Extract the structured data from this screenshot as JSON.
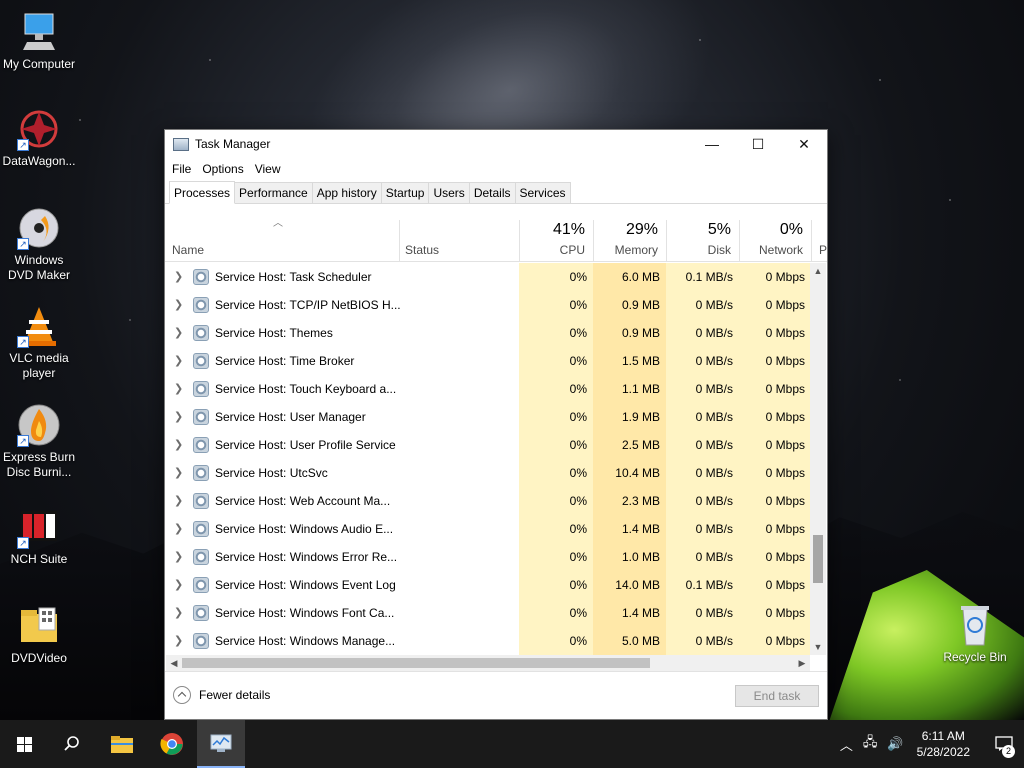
{
  "desktop": {
    "icons": [
      {
        "label": "My Computer"
      },
      {
        "label": "DataWagon..."
      },
      {
        "label": "Windows DVD Maker"
      },
      {
        "label": "VLC media player"
      },
      {
        "label": "Express Burn Disc Burni..."
      },
      {
        "label": "NCH Suite"
      },
      {
        "label": "DVDVideo"
      },
      {
        "label": "Recycle Bin"
      }
    ]
  },
  "window": {
    "title": "Task Manager",
    "controls": {
      "minimize": "—",
      "maximize": "☐",
      "close": "✕"
    },
    "menu": [
      "File",
      "Options",
      "View"
    ],
    "tabs": [
      "Processes",
      "Performance",
      "App history",
      "Startup",
      "Users",
      "Details",
      "Services"
    ],
    "active_tab": "Processes",
    "columns": {
      "name": "Name",
      "status": "Status",
      "cpu": {
        "pct": "41%",
        "label": "CPU"
      },
      "memory": {
        "pct": "29%",
        "label": "Memory"
      },
      "disk": {
        "pct": "5%",
        "label": "Disk"
      },
      "network": {
        "pct": "0%",
        "label": "Network"
      },
      "extra": "P"
    },
    "rows": [
      {
        "name": "Service Host: Task Scheduler",
        "status": "",
        "cpu": "0%",
        "memory": "6.0 MB",
        "disk": "0.1 MB/s",
        "network": "0 Mbps"
      },
      {
        "name": "Service Host: TCP/IP NetBIOS H...",
        "status": "",
        "cpu": "0%",
        "memory": "0.9 MB",
        "disk": "0 MB/s",
        "network": "0 Mbps"
      },
      {
        "name": "Service Host: Themes",
        "status": "",
        "cpu": "0%",
        "memory": "0.9 MB",
        "disk": "0 MB/s",
        "network": "0 Mbps"
      },
      {
        "name": "Service Host: Time Broker",
        "status": "",
        "cpu": "0%",
        "memory": "1.5 MB",
        "disk": "0 MB/s",
        "network": "0 Mbps"
      },
      {
        "name": "Service Host: Touch Keyboard a...",
        "status": "",
        "cpu": "0%",
        "memory": "1.1 MB",
        "disk": "0 MB/s",
        "network": "0 Mbps"
      },
      {
        "name": "Service Host: User Manager",
        "status": "",
        "cpu": "0%",
        "memory": "1.9 MB",
        "disk": "0 MB/s",
        "network": "0 Mbps"
      },
      {
        "name": "Service Host: User Profile Service",
        "status": "",
        "cpu": "0%",
        "memory": "2.5 MB",
        "disk": "0 MB/s",
        "network": "0 Mbps"
      },
      {
        "name": "Service Host: UtcSvc",
        "status": "",
        "cpu": "0%",
        "memory": "10.4 MB",
        "disk": "0 MB/s",
        "network": "0 Mbps"
      },
      {
        "name": "Service Host: Web Account Ma...",
        "status": "",
        "cpu": "0%",
        "memory": "2.3 MB",
        "disk": "0 MB/s",
        "network": "0 Mbps"
      },
      {
        "name": "Service Host: Windows Audio E...",
        "status": "",
        "cpu": "0%",
        "memory": "1.4 MB",
        "disk": "0 MB/s",
        "network": "0 Mbps"
      },
      {
        "name": "Service Host: Windows Error Re...",
        "status": "",
        "cpu": "0%",
        "memory": "1.0 MB",
        "disk": "0 MB/s",
        "network": "0 Mbps"
      },
      {
        "name": "Service Host: Windows Event Log",
        "status": "",
        "cpu": "0%",
        "memory": "14.0 MB",
        "disk": "0.1 MB/s",
        "network": "0 Mbps"
      },
      {
        "name": "Service Host: Windows Font Ca...",
        "status": "",
        "cpu": "0%",
        "memory": "1.4 MB",
        "disk": "0 MB/s",
        "network": "0 Mbps"
      },
      {
        "name": "Service Host: Windows Manage...",
        "status": "",
        "cpu": "0%",
        "memory": "5.0 MB",
        "disk": "0 MB/s",
        "network": "0 Mbps"
      }
    ],
    "footer": {
      "fewer_details": "Fewer details",
      "end_task": "End task"
    }
  },
  "taskbar": {
    "items": [
      "start-icon",
      "search-icon",
      "file-explorer-icon",
      "chrome-icon",
      "task-manager-icon"
    ],
    "clock": {
      "time": "6:11 AM",
      "date": "5/28/2022"
    },
    "notification_count": "2"
  }
}
